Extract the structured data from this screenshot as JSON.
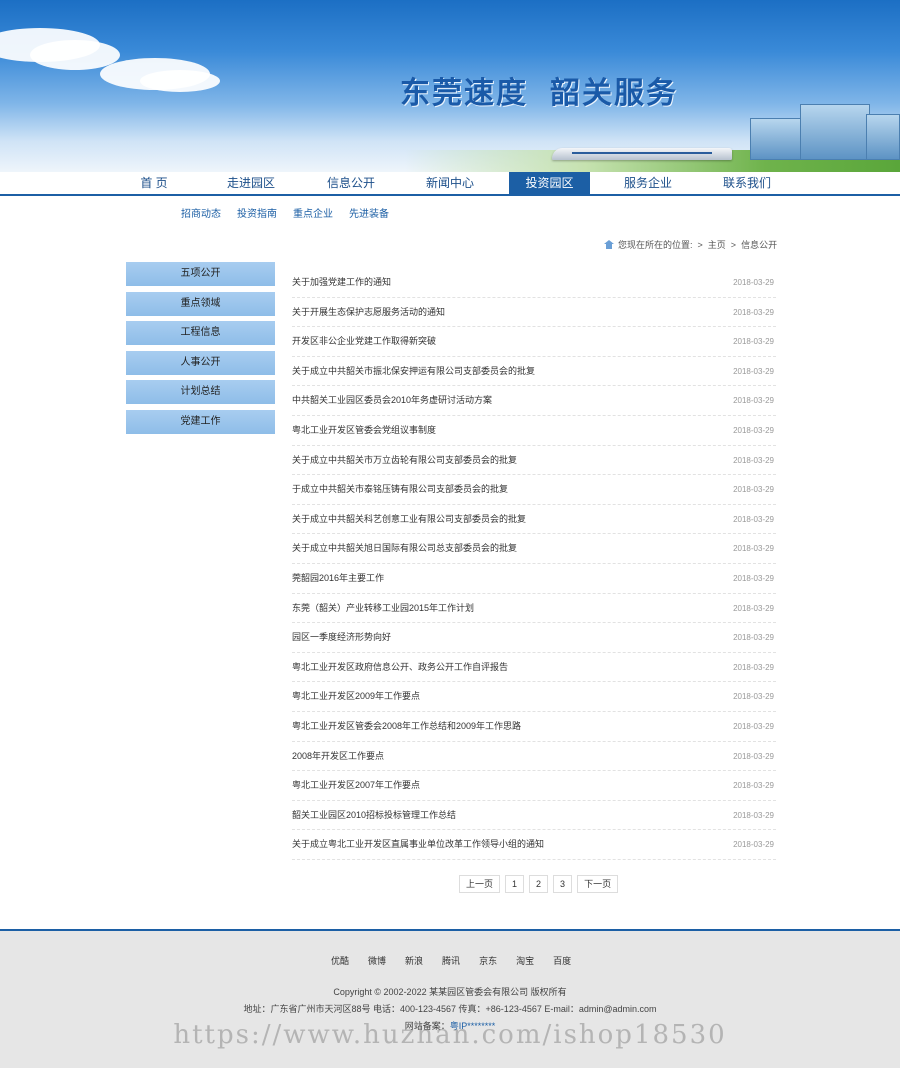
{
  "banner": {
    "title_left": "东莞速度",
    "title_right": "韶关服务"
  },
  "nav": {
    "items": [
      "首 页",
      "走进园区",
      "信息公开",
      "新闻中心",
      "投资园区",
      "服务企业",
      "联系我们"
    ],
    "active": "投资园区"
  },
  "subnav": {
    "items": [
      "招商动态",
      "投资指南",
      "重点企业",
      "先进装备"
    ]
  },
  "breadcrumb": {
    "prefix": "您现在所在的位置:",
    "sep": ">",
    "home": "主页",
    "current": "信息公开"
  },
  "sidebar": {
    "items": [
      "五项公开",
      "重点领域",
      "工程信息",
      "人事公开",
      "计划总结",
      "党建工作"
    ]
  },
  "articles": [
    {
      "title": "关于加强党建工作的通知",
      "date": "2018-03-29"
    },
    {
      "title": "关于开展生态保护志愿服务活动的通知",
      "date": "2018-03-29"
    },
    {
      "title": "开发区非公企业党建工作取得新突破",
      "date": "2018-03-29"
    },
    {
      "title": "关于成立中共韶关市振北保安押运有限公司支部委员会的批复",
      "date": "2018-03-29"
    },
    {
      "title": "中共韶关工业园区委员会2010年务虚研讨活动方案",
      "date": "2018-03-29"
    },
    {
      "title": "粤北工业开发区管委会党组议事制度",
      "date": "2018-03-29"
    },
    {
      "title": "关于成立中共韶关市万立齿轮有限公司支部委员会的批复",
      "date": "2018-03-29"
    },
    {
      "title": "于成立中共韶关市泰铭压铸有限公司支部委员会的批复",
      "date": "2018-03-29"
    },
    {
      "title": "关于成立中共韶关科艺创意工业有限公司支部委员会的批复",
      "date": "2018-03-29"
    },
    {
      "title": "关于成立中共韶关旭日国际有限公司总支部委员会的批复",
      "date": "2018-03-29"
    },
    {
      "title": "莞韶园2016年主要工作",
      "date": "2018-03-29"
    },
    {
      "title": "东莞（韶关）产业转移工业园2015年工作计划",
      "date": "2018-03-29"
    },
    {
      "title": "园区一季度经济形势向好",
      "date": "2018-03-29"
    },
    {
      "title": "粤北工业开发区政府信息公开、政务公开工作自评报告",
      "date": "2018-03-29"
    },
    {
      "title": "粤北工业开发区2009年工作要点",
      "date": "2018-03-29"
    },
    {
      "title": "粤北工业开发区管委会2008年工作总结和2009年工作思路",
      "date": "2018-03-29"
    },
    {
      "title": "2008年开发区工作要点",
      "date": "2018-03-29"
    },
    {
      "title": "粤北工业开发区2007年工作要点",
      "date": "2018-03-29"
    },
    {
      "title": "韶关工业园区2010招标投标管理工作总结",
      "date": "2018-03-29"
    },
    {
      "title": "关于成立粤北工业开发区直属事业单位改革工作领导小组的通知",
      "date": "2018-03-29"
    }
  ],
  "pagination": {
    "prev": "上一页",
    "pages": [
      "1",
      "2",
      "3"
    ],
    "next": "下一页"
  },
  "footer": {
    "links": [
      "优酷",
      "微博",
      "新浪",
      "腾讯",
      "京东",
      "淘宝",
      "百度"
    ],
    "copyright": "Copyright © 2002-2022 某某园区管委会有限公司 版权所有",
    "address": "地址：广东省广州市天河区88号 电话：400-123-4567   传真：+86-123-4567   E-mail：admin@admin.com",
    "icp_label": "网站备案：",
    "icp_value": "粤IP********"
  },
  "watermark": "https://www.huzhan.com/ishop18530"
}
